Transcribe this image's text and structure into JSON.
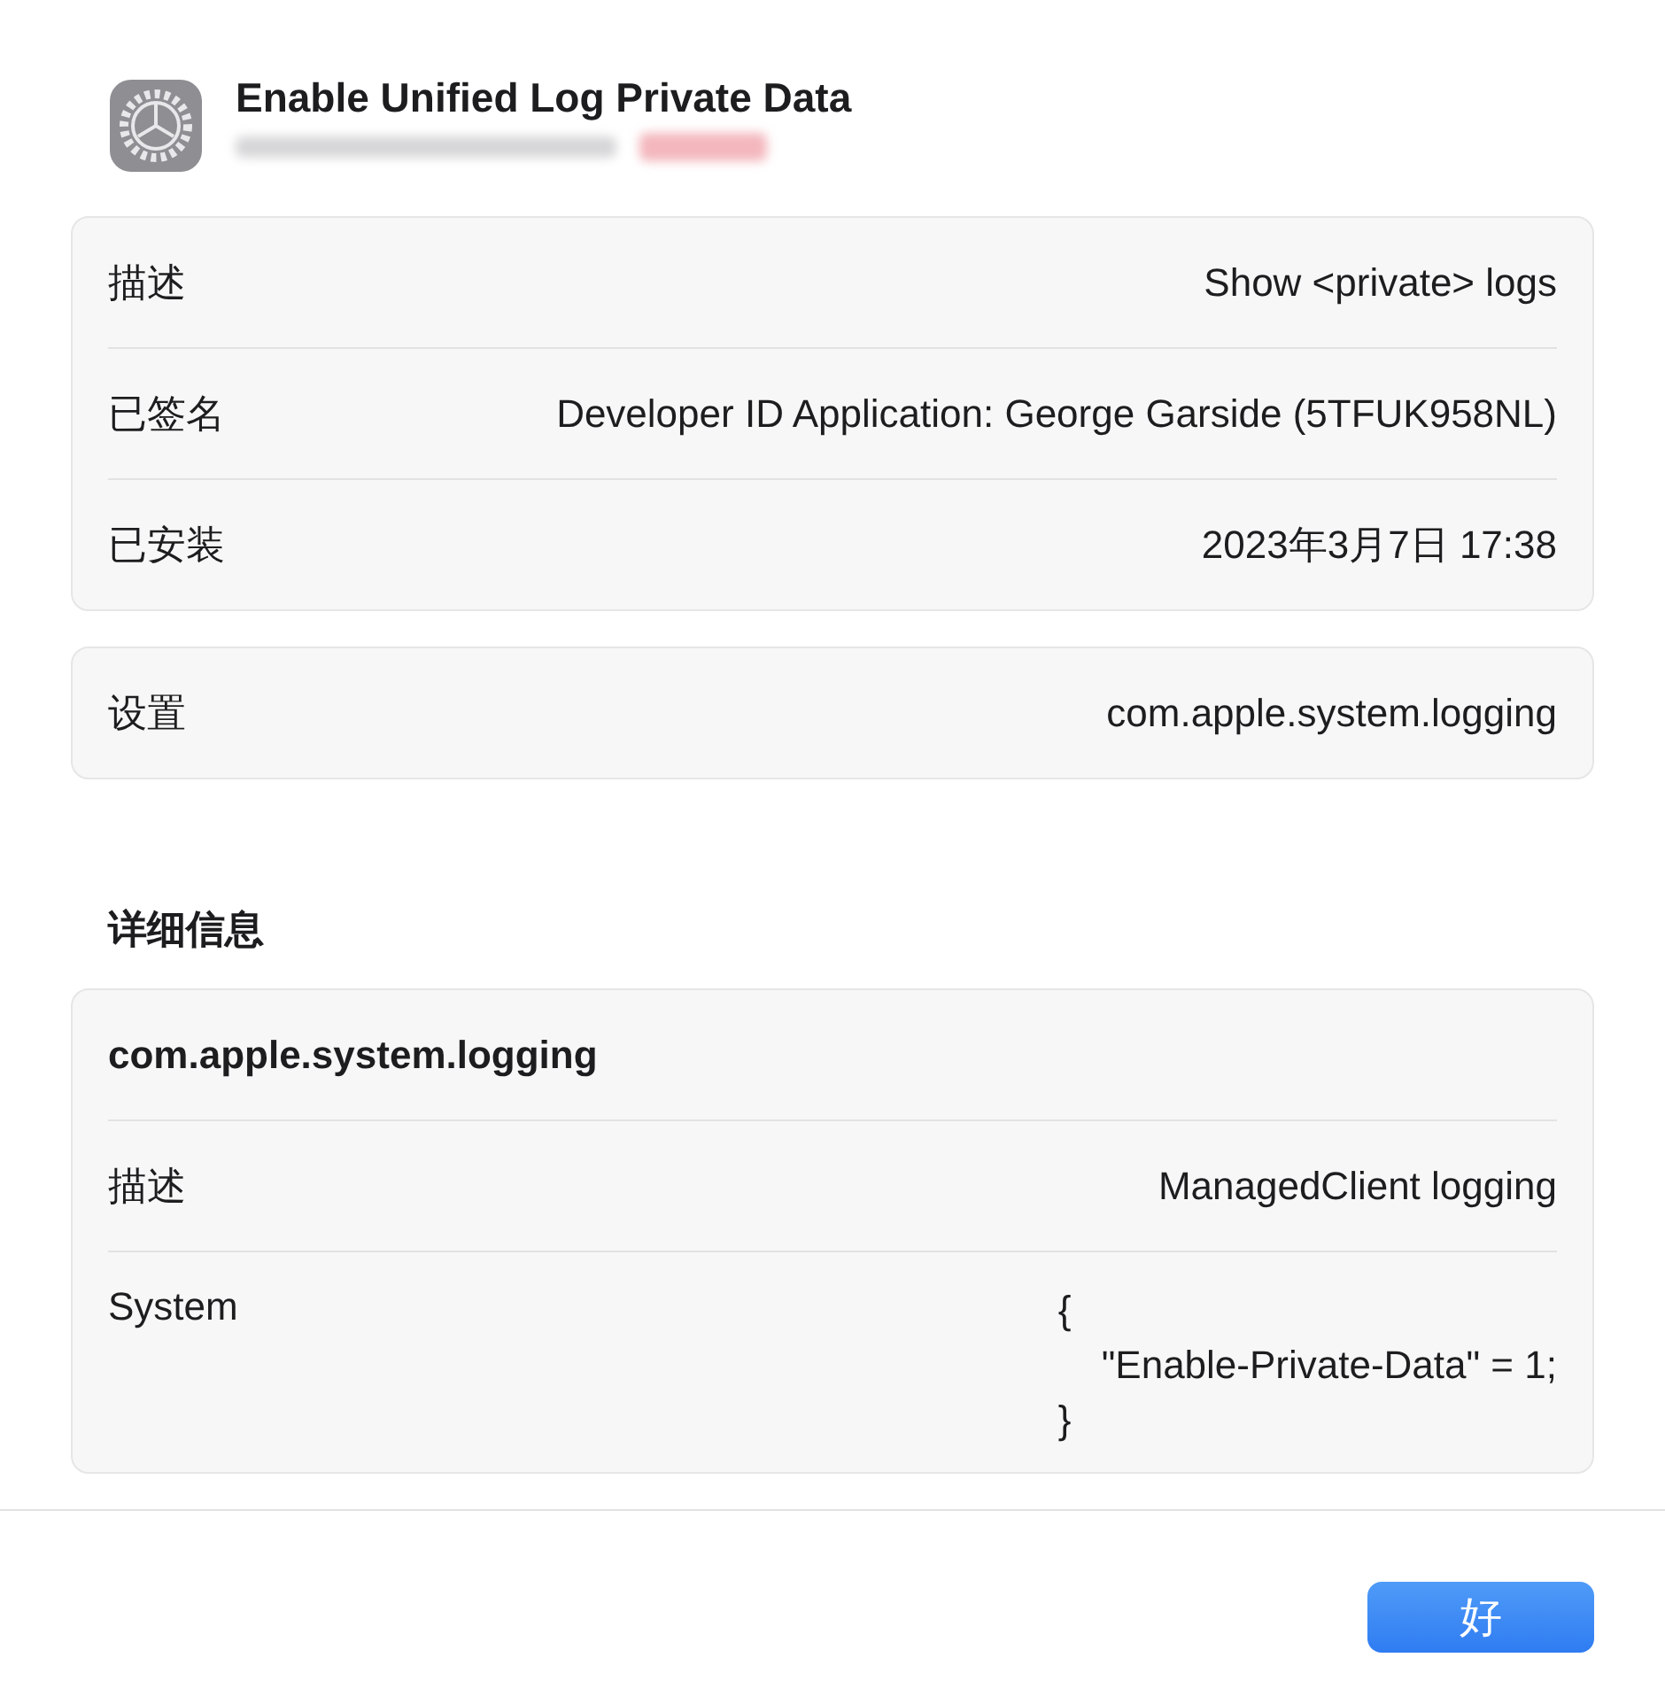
{
  "window": {
    "title": "Enable Unified Log Private Data"
  },
  "summary": [
    {
      "label": "描述",
      "value": "Show <private> logs"
    },
    {
      "label": "已签名",
      "value": "Developer ID Application: George Garside (5TFUK958NL)"
    },
    {
      "label": "已安装",
      "value": "2023年3月7日 17:38"
    }
  ],
  "settings": [
    {
      "label": "设置",
      "value": "com.apple.system.logging"
    }
  ],
  "details_heading": "详细信息",
  "details": {
    "title": "com.apple.system.logging",
    "rows": [
      {
        "label": "描述",
        "value": "ManagedClient logging",
        "kind": "text"
      },
      {
        "label": "System",
        "value": "{\n    \"Enable-Private-Data\" = 1;\n}",
        "kind": "code"
      }
    ]
  },
  "buttons": [
    {
      "label": "好",
      "default": true
    }
  ]
}
